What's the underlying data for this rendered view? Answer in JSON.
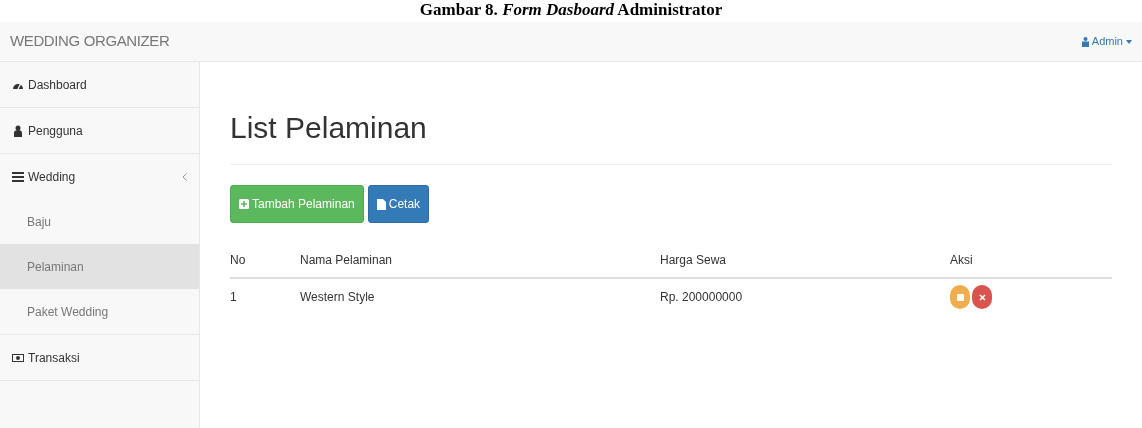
{
  "caption": "Gambar 8. *Form Dasboard* Administrator",
  "navbar": {
    "brand": "WEDDING ORGANIZER",
    "user": "Admin"
  },
  "sidebar": {
    "items": [
      {
        "label": "Dashboard",
        "kind": "dashboard",
        "selected": false
      },
      {
        "label": "Pengguna",
        "kind": "user",
        "selected": false
      },
      {
        "label": "Wedding",
        "kind": "list",
        "selected": false,
        "expanded": true,
        "children": [
          {
            "label": "Baju",
            "selected": false
          },
          {
            "label": "Pelaminan",
            "selected": true
          },
          {
            "label": "Paket Wedding",
            "selected": false
          }
        ]
      },
      {
        "label": "Transaksi",
        "kind": "money",
        "selected": false
      }
    ]
  },
  "page_title": "List Pelaminan",
  "buttons": [
    {
      "label": "Tambah Pelaminan",
      "kind": "add"
    },
    {
      "label": "Cetak",
      "kind": "print"
    }
  ],
  "table": {
    "columns": [
      "No",
      "Nama Pelaminan",
      "Harga Sewa",
      "Aksi"
    ],
    "rows": [
      {
        "cells": [
          "1",
          "Western Style",
          "Rp. 200000000"
        ]
      }
    ]
  }
}
